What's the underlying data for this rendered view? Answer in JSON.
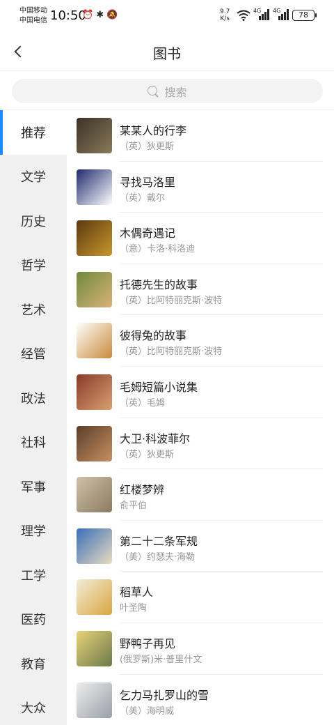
{
  "status_bar": {
    "carrier1": "中国移动",
    "carrier2": "中国电信",
    "time": "10:50",
    "net_speed_value": "9.7",
    "net_speed_unit": "K/s",
    "sig1_label": "4G",
    "sig2_label": "4G",
    "battery": "78"
  },
  "header": {
    "title": "图书"
  },
  "search": {
    "placeholder": "搜索"
  },
  "sidebar": {
    "categories": [
      {
        "label": "推荐",
        "active": true
      },
      {
        "label": "文学"
      },
      {
        "label": "历史"
      },
      {
        "label": "哲学"
      },
      {
        "label": "艺术"
      },
      {
        "label": "经管"
      },
      {
        "label": "政法"
      },
      {
        "label": "社科"
      },
      {
        "label": "军事"
      },
      {
        "label": "理学"
      },
      {
        "label": "工学"
      },
      {
        "label": "医药"
      },
      {
        "label": "教育"
      },
      {
        "label": "大众"
      }
    ]
  },
  "books": [
    {
      "title": "某某人的行李",
      "author": "（英）狄更斯",
      "cover_colors": [
        "#3a3226",
        "#8a7a5a"
      ]
    },
    {
      "title": "寻找马洛里",
      "author": "（英）戴尔",
      "cover_colors": [
        "#1f2a6e",
        "#ffffff"
      ]
    },
    {
      "title": "木偶奇遇记",
      "author": "（意）卡洛·科洛迪",
      "cover_colors": [
        "#5a3a12",
        "#c8962a"
      ]
    },
    {
      "title": "托德先生的故事",
      "author": "（英）比阿特丽克斯·波特",
      "cover_colors": [
        "#6e8a3c",
        "#d9b27a"
      ]
    },
    {
      "title": "彼得兔的故事",
      "author": "（英）比阿特丽克斯·波特",
      "cover_colors": [
        "#ffffff",
        "#c98a3a"
      ]
    },
    {
      "title": "毛姆短篇小说集",
      "author": "（英）毛姆",
      "cover_colors": [
        "#8a3a2a",
        "#d9a070"
      ]
    },
    {
      "title": "大卫·科波菲尔",
      "author": "（英）狄更斯",
      "cover_colors": [
        "#5a3e2a",
        "#c89060"
      ]
    },
    {
      "title": "红楼梦辨",
      "author": "俞平伯",
      "cover_colors": [
        "#cfc2a8",
        "#8a7a60"
      ]
    },
    {
      "title": "第二十二条军规",
      "author": "（美）约瑟夫·海勒",
      "cover_colors": [
        "#3a6fb8",
        "#e9dcc0"
      ]
    },
    {
      "title": "稻草人",
      "author": "叶圣陶",
      "cover_colors": [
        "#f3ecd8",
        "#d9a640"
      ]
    },
    {
      "title": "野鸭子再见",
      "author": "(俄罗斯)米·普里什文",
      "cover_colors": [
        "#e8d27a",
        "#6a7a4a"
      ]
    },
    {
      "title": "乞力马扎罗山的雪",
      "author": "（美）海明威",
      "cover_colors": [
        "#ececec",
        "#9aa0a8"
      ]
    }
  ]
}
